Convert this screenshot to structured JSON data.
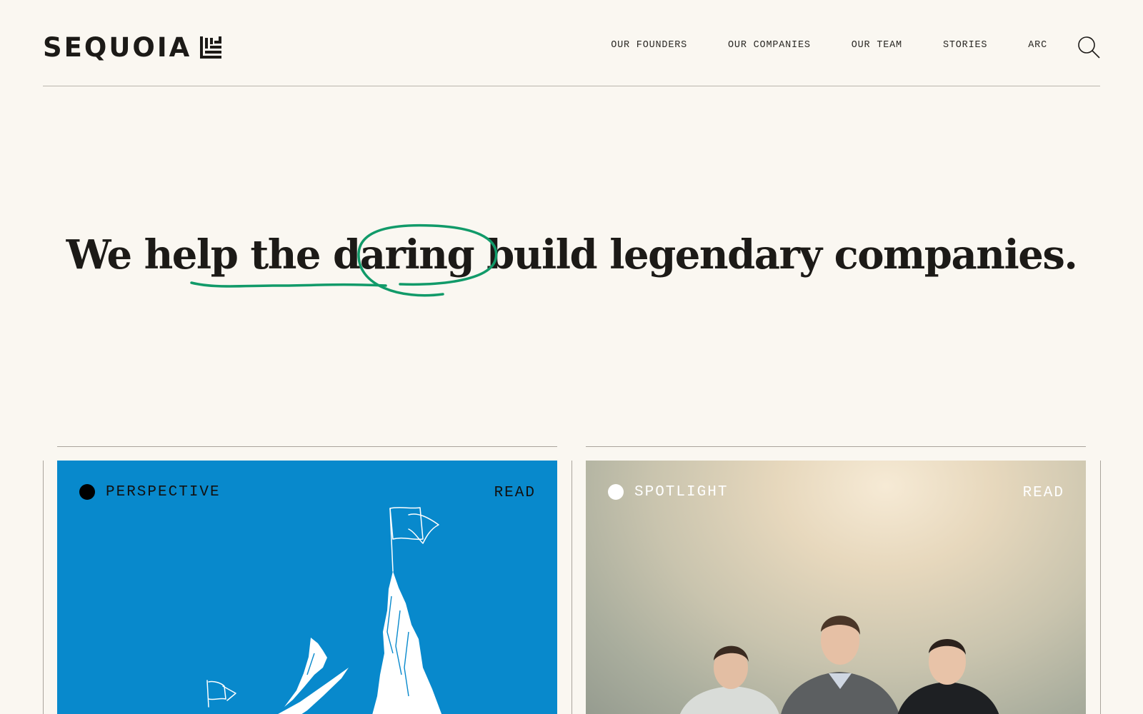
{
  "brand": {
    "name": "SEQUOIA"
  },
  "nav": {
    "items": [
      {
        "label": "OUR FOUNDERS"
      },
      {
        "label": "OUR COMPANIES"
      },
      {
        "label": "OUR TEAM"
      },
      {
        "label": "STORIES"
      },
      {
        "label": "ARC"
      }
    ],
    "search_icon": "search-icon"
  },
  "hero": {
    "headline": "We help the daring build legendary companies.",
    "highlight_color": "#119a69"
  },
  "cards": [
    {
      "tag": "PERSPECTIVE",
      "cta": "READ",
      "background": "#0889cc",
      "dot_color": "#000000",
      "text_color": "#111111",
      "image": "mountain-summit-flag-illustration"
    },
    {
      "tag": "SPOTLIGHT",
      "cta": "READ",
      "dot_color": "#ffffff",
      "text_color": "#ffffff",
      "image": "three-founders-photo"
    }
  ],
  "colors": {
    "background": "#faf7f1",
    "text": "#1c1a17",
    "rule": "#b9b4ac"
  }
}
